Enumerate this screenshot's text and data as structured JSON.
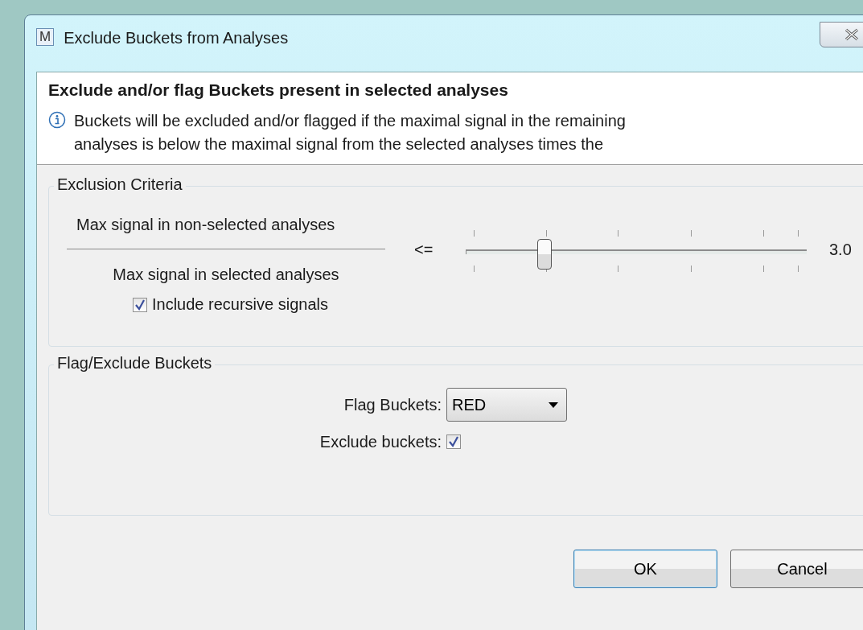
{
  "window": {
    "icon_letter": "M",
    "title": "Exclude Buckets from Analyses"
  },
  "header": {
    "title": "Exclude and/or flag Buckets present in selected analyses",
    "info": "Buckets will be excluded and/or flagged if the maximal signal in the remaining analyses is below the maximal signal from the selected analyses times the"
  },
  "exclusion_criteria": {
    "title": "Exclusion Criteria",
    "numerator": "Max signal in non-selected analyses",
    "denominator": "Max signal in selected analyses",
    "operator": "<=",
    "slider": {
      "level": 0.22
    },
    "reading": "3.0",
    "include_recursive": {
      "label": "Include recursive signals",
      "checked": true
    }
  },
  "flag_exclude": {
    "title": "Flag/Exclude Buckets",
    "flag_label": "Flag Buckets:",
    "flag_value": "RED",
    "exclude_label": "Exclude buckets:",
    "exclude_checked": true
  },
  "buttons": [
    {
      "label": "OK",
      "default": true
    },
    {
      "label": "Cancel",
      "default": false
    }
  ]
}
